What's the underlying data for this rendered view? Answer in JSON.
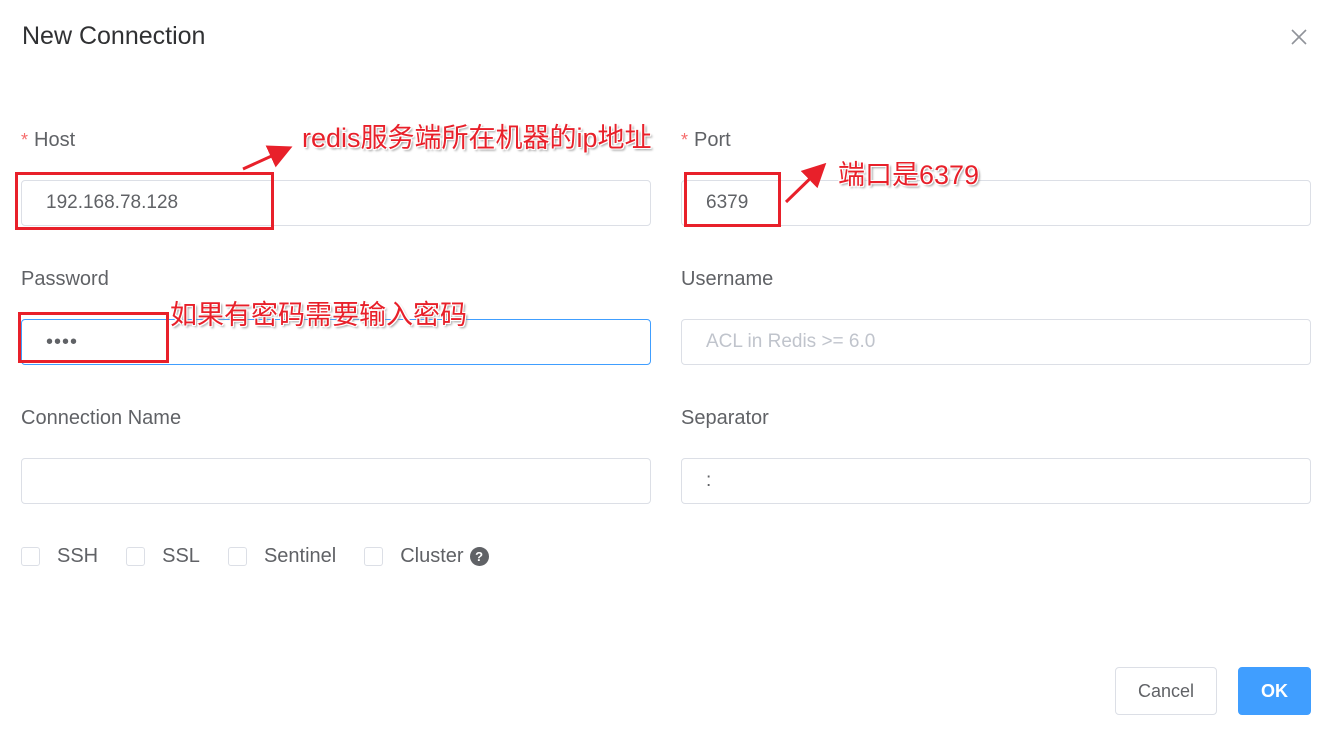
{
  "dialog": {
    "title": "New Connection",
    "close_icon": "close-icon"
  },
  "form": {
    "host": {
      "label": "Host",
      "required_mark": "*",
      "value": "192.168.78.128"
    },
    "port": {
      "label": "Port",
      "required_mark": "*",
      "value": "6379"
    },
    "password": {
      "label": "Password",
      "value_masked": "••••"
    },
    "username": {
      "label": "Username",
      "value": "",
      "placeholder": "ACL in Redis >= 6.0"
    },
    "connection_name": {
      "label": "Connection Name",
      "value": ""
    },
    "separator": {
      "label": "Separator",
      "value": ":"
    }
  },
  "options": [
    {
      "label": "SSH",
      "checked": false
    },
    {
      "label": "SSL",
      "checked": false
    },
    {
      "label": "Sentinel",
      "checked": false
    },
    {
      "label": "Cluster",
      "checked": false,
      "help_icon": "question-circle-icon",
      "help_glyph": "?"
    }
  ],
  "footer": {
    "cancel_label": "Cancel",
    "ok_label": "OK"
  },
  "annotations": {
    "host_note": "redis服务端所在机器的ip地址",
    "port_note": "端口是6379",
    "password_note": "如果有密码需要输入密码"
  },
  "colors": {
    "primary": "#409eff",
    "required": "#f56c6c",
    "annotation": "#e8202a"
  }
}
